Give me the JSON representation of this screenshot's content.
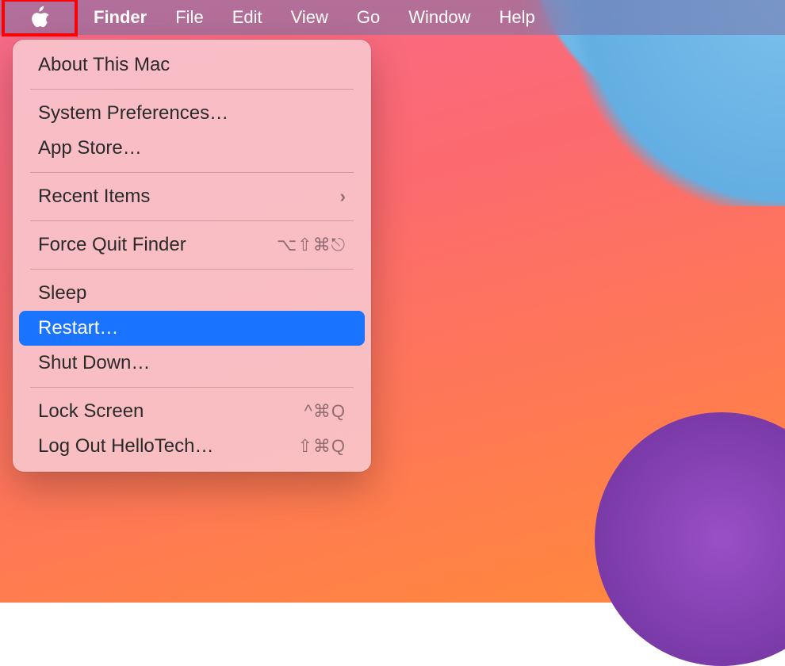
{
  "menubar": {
    "app_name": "Finder",
    "items": [
      {
        "label": "File"
      },
      {
        "label": "Edit"
      },
      {
        "label": "View"
      },
      {
        "label": "Go"
      },
      {
        "label": "Window"
      },
      {
        "label": "Help"
      }
    ]
  },
  "apple_menu": {
    "about": "About This Mac",
    "system_prefs": "System Preferences…",
    "app_store": "App Store…",
    "recent_items": "Recent Items",
    "force_quit": "Force Quit Finder",
    "force_quit_shortcut": "⌥⇧⌘⎋",
    "sleep": "Sleep",
    "restart": "Restart…",
    "shut_down": "Shut Down…",
    "lock_screen": "Lock Screen",
    "lock_screen_shortcut": "^⌘Q",
    "log_out": "Log Out HelloTech…",
    "log_out_shortcut": "⇧⌘Q"
  }
}
